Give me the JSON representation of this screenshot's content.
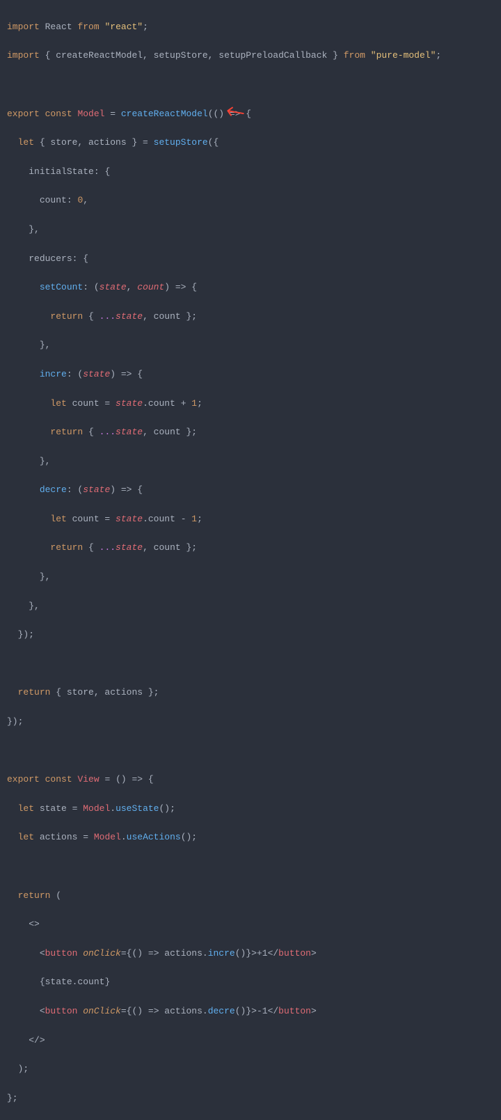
{
  "code": {
    "line1_import": "import",
    "line1_react": "React",
    "line1_from": "from",
    "line1_reactstr": "\"react\"",
    "line1_semi": ";",
    "line2_import": "import",
    "line2_braces_open": "{ ",
    "line2_names": "createReactModel, setupStore, setupPreloadCallback",
    "line2_braces_close": " }",
    "line2_from": "from",
    "line2_pure": "\"pure-model\"",
    "line2_semi": ";",
    "line4_export": "export",
    "line4_const": "const",
    "line4_model": "Model",
    "line4_eq": " = ",
    "line4_crm": "createReactModel",
    "line4_tail": "(() => {",
    "line5_let": "let",
    "line5_destr": " { store, actions } = ",
    "line5_setup": "setupStore",
    "line5_open": "({",
    "line6_initial": "initialState",
    "line6_colon": ": {",
    "line7_count": "count",
    "line7_val": ": ",
    "line7_zero": "0",
    "line7_comma": ",",
    "line8_close": "},",
    "line9_reducers": "reducers",
    "line9_colon": ": {",
    "line10_setcount": "setCount",
    "line10_colon": ": (",
    "line10_state": "state",
    "line10_comma": ", ",
    "line10_count": "count",
    "line10_tail": ") => {",
    "line11_return": "return",
    "line11_open": " { ",
    "line11_spread": "...",
    "line11_state": "state",
    "line11_tail": ", count };",
    "line12_close": "},",
    "line13_incre": "incre",
    "line13_colon": ": (",
    "line13_state": "state",
    "line13_tail": ") => {",
    "line14_let": "let",
    "line14_count": " count = ",
    "line14_state": "state",
    "line14_dot": ".",
    "line14_prop": "count",
    "line14_plus": " + ",
    "line14_one": "1",
    "line14_semi": ";",
    "line15_return": "return",
    "line15_open": " { ",
    "line15_spread": "...",
    "line15_state": "state",
    "line15_tail": ", count };",
    "line16_close": "},",
    "line17_decre": "decre",
    "line17_colon": ": (",
    "line17_state": "state",
    "line17_tail": ") => {",
    "line18_let": "let",
    "line18_count": " count = ",
    "line18_state": "state",
    "line18_dot": ".",
    "line18_prop": "count",
    "line18_minus": " - ",
    "line18_one": "1",
    "line18_semi": ";",
    "line19_return": "return",
    "line19_open": " { ",
    "line19_spread": "...",
    "line19_state": "state",
    "line19_tail": ", count };",
    "line20_close": "},",
    "line21_close": "},",
    "line22_close": "});",
    "line24_return": "return",
    "line24_tail": " { store, actions };",
    "line25_close": "});",
    "line27_export": "export",
    "line27_const": "const",
    "line27_view": "View",
    "line27_eq": " = () => {",
    "line28_let": "let",
    "line28_state": " state = ",
    "line28_model": "Model",
    "line28_dot": ".",
    "line28_usestate": "useState",
    "line28_tail": "();",
    "line29_let": "let",
    "line29_actions": " actions = ",
    "line29_model": "Model",
    "line29_dot": ".",
    "line29_useactions": "useActions",
    "line29_tail": "();",
    "line31_return": "return",
    "line31_open": " (",
    "line32_frag": "<>",
    "line33_open": "<",
    "line33_button": "button",
    "line33_space": " ",
    "line33_onclick": "onClick",
    "line33_eq": "=",
    "line33_braceopen": "{",
    "line33_arrow": "() => actions.",
    "line33_incre": "incre",
    "line33_call": "()",
    "line33_braceclose": "}",
    "line33_gt": ">",
    "line33_text": "+1",
    "line33_close": "</",
    "line33_button2": "button",
    "line33_gt2": ">",
    "line34_open": "{",
    "line34_expr": "state.count",
    "line34_close": "}",
    "line35_open": "<",
    "line35_button": "button",
    "line35_space": " ",
    "line35_onclick": "onClick",
    "line35_eq": "=",
    "line35_braceopen": "{",
    "line35_arrow": "() => actions.",
    "line35_decre": "decre",
    "line35_call": "()",
    "line35_braceclose": "}",
    "line35_gt": ">",
    "line35_text": "-1",
    "line35_close": "</",
    "line35_button2": "button",
    "line35_gt2": ">",
    "line36_frag": "</>",
    "line37_close": ");",
    "line38_close": "};"
  },
  "annotation": {
    "arrow": "↖"
  }
}
